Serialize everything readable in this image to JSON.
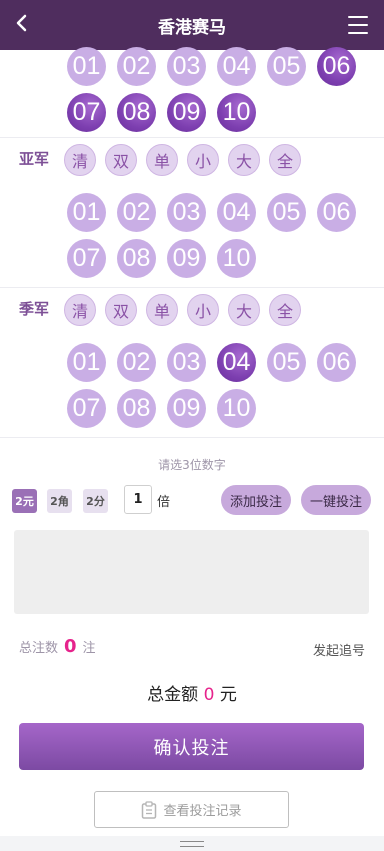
{
  "header": {
    "title": "香港赛马"
  },
  "row_top": {
    "balls": [
      {
        "n": "01",
        "sel": false
      },
      {
        "n": "02",
        "sel": false
      },
      {
        "n": "03",
        "sel": false
      },
      {
        "n": "04",
        "sel": false
      },
      {
        "n": "05",
        "sel": false
      },
      {
        "n": "06",
        "sel": true
      },
      {
        "n": "07",
        "sel": true
      },
      {
        "n": "08",
        "sel": true
      },
      {
        "n": "09",
        "sel": true
      },
      {
        "n": "10",
        "sel": true
      }
    ]
  },
  "row_second": {
    "label": "亚军",
    "quick": [
      "清",
      "双",
      "单",
      "小",
      "大",
      "全"
    ],
    "balls": [
      {
        "n": "01",
        "sel": false
      },
      {
        "n": "02",
        "sel": false
      },
      {
        "n": "03",
        "sel": false
      },
      {
        "n": "04",
        "sel": false
      },
      {
        "n": "05",
        "sel": false
      },
      {
        "n": "06",
        "sel": false
      },
      {
        "n": "07",
        "sel": false
      },
      {
        "n": "08",
        "sel": false
      },
      {
        "n": "09",
        "sel": false
      },
      {
        "n": "10",
        "sel": false
      }
    ]
  },
  "row_third": {
    "label": "季军",
    "quick": [
      "清",
      "双",
      "单",
      "小",
      "大",
      "全"
    ],
    "balls": [
      {
        "n": "01",
        "sel": false
      },
      {
        "n": "02",
        "sel": false
      },
      {
        "n": "03",
        "sel": false
      },
      {
        "n": "04",
        "sel": true
      },
      {
        "n": "05",
        "sel": false
      },
      {
        "n": "06",
        "sel": false
      },
      {
        "n": "07",
        "sel": false
      },
      {
        "n": "08",
        "sel": false
      },
      {
        "n": "09",
        "sel": false
      },
      {
        "n": "10",
        "sel": false
      }
    ]
  },
  "hint": "请选3位数字",
  "units": [
    {
      "label": "2元",
      "active": true
    },
    {
      "label": "2角",
      "active": false
    },
    {
      "label": "2分",
      "active": false
    }
  ],
  "multiplier": {
    "value": "1",
    "suffix": "倍"
  },
  "buttons": {
    "add_bet": "添加投注",
    "one_click": "一键投注",
    "confirm": "确认投注",
    "records": "查看投注记录"
  },
  "summary": {
    "count_label": "总注数",
    "count_value": "0",
    "count_unit": "注",
    "chase": "发起追号",
    "amount_label": "总金额",
    "amount_value": "0",
    "amount_unit": "元"
  },
  "colors": {
    "header": "#4f2d5e",
    "ball": "#c9aee5",
    "ball_selected": "#7d3fb0",
    "accent": "#e6238c"
  }
}
